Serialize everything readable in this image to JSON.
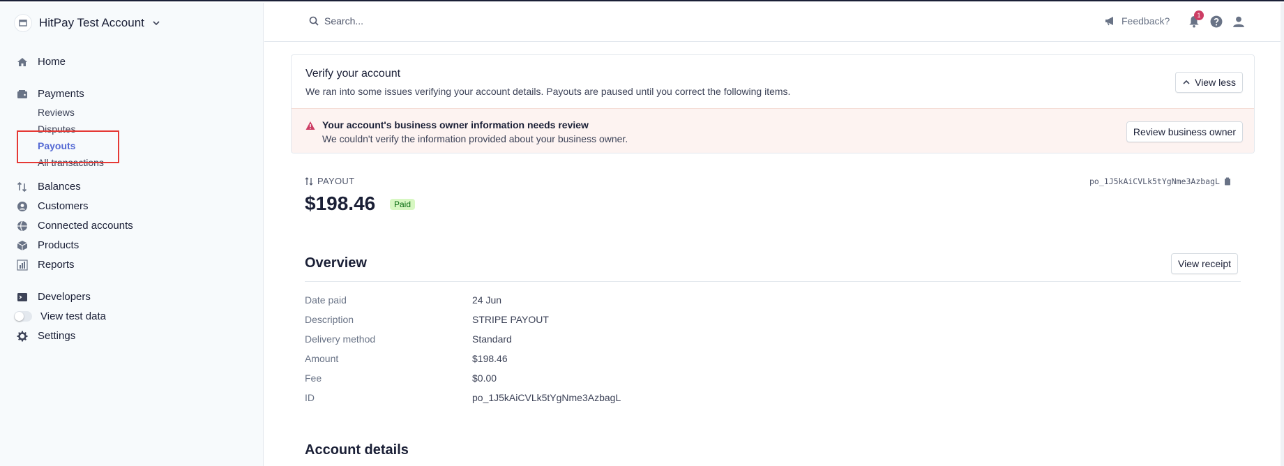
{
  "sidebar": {
    "account_name": "HitPay Test Account",
    "nav": {
      "home": "Home",
      "payments": "Payments",
      "reviews": "Reviews",
      "disputes": "Disputes",
      "payouts": "Payouts",
      "all_transactions": "All transactions",
      "balances": "Balances",
      "customers": "Customers",
      "connected_accounts": "Connected accounts",
      "products": "Products",
      "reports": "Reports",
      "developers": "Developers",
      "view_test_data": "View test data",
      "settings": "Settings"
    }
  },
  "topbar": {
    "search_placeholder": "Search...",
    "feedback": "Feedback?",
    "notification_count": "1"
  },
  "verify": {
    "title": "Verify your account",
    "description": "We ran into some issues verifying your account details. Payouts are paused until you correct the following items.",
    "view_less": "View less",
    "warning_title": "Your account's business owner information needs review",
    "warning_desc": "We couldn't verify the information provided about your business owner.",
    "review_button": "Review business owner"
  },
  "payout": {
    "label": "PAYOUT",
    "amount": "$198.46",
    "status": "Paid",
    "id": "po_1J5kAiCVLk5tYgNme3AzbagL"
  },
  "overview": {
    "title": "Overview",
    "view_receipt": "View receipt",
    "rows": [
      {
        "label": "Date paid",
        "value": "24 Jun"
      },
      {
        "label": "Description",
        "value": "STRIPE PAYOUT"
      },
      {
        "label": "Delivery method",
        "value": "Standard"
      },
      {
        "label": "Amount",
        "value": "$198.46"
      },
      {
        "label": "Fee",
        "value": "$0.00"
      },
      {
        "label": "ID",
        "value": "po_1J5kAiCVLk5tYgNme3AzbagL"
      }
    ]
  },
  "account_details": {
    "title": "Account details"
  },
  "colors": {
    "accent": "#5469d4",
    "highlight": "#e53935",
    "paid_bg": "#d7f7c2",
    "paid_text": "#05690d",
    "warning_bg": "#fdf3f1",
    "warning_icon": "#cd3d64"
  }
}
